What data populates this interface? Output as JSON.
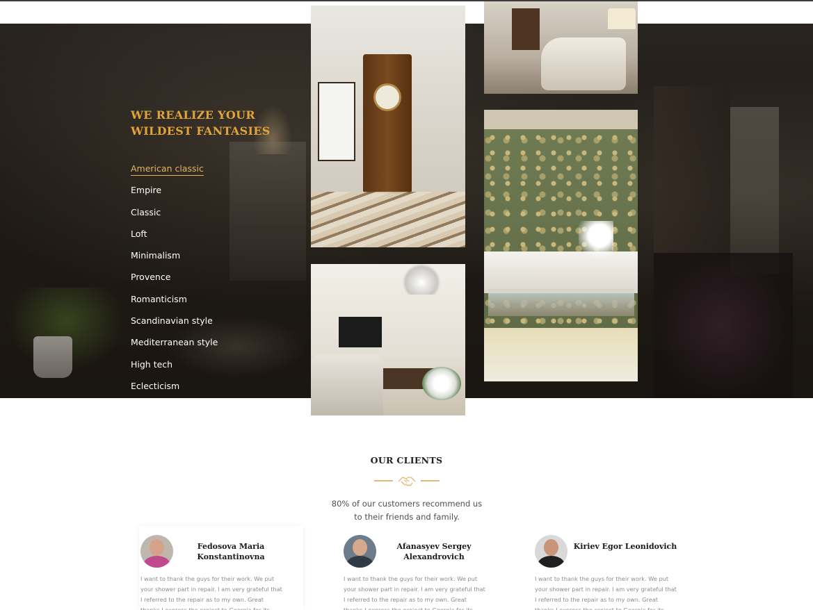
{
  "hero": {
    "title": "WE REALIZE YOUR WILDEST FANTASIES",
    "styles": [
      "American classic",
      "Empire",
      "Classic",
      "Loft",
      "Minimalism",
      "Provence",
      "Romanticism",
      "Scandinavian style",
      "Mediterranean style",
      "High tech",
      "Eclecticism"
    ],
    "active_style": "American classic",
    "accent_color": "#e0a43b"
  },
  "gallery": {
    "photos": [
      {
        "name": "interior-photo-clock-cabinet"
      },
      {
        "name": "interior-photo-tv-room"
      },
      {
        "name": "interior-photo-sofa-lamp"
      },
      {
        "name": "interior-photo-wallpaper-orchid"
      }
    ]
  },
  "clients": {
    "title": "OUR CLIENTS",
    "divider_icon": "handshake-icon",
    "description": "80% of our customers recommend us to their friends and family.",
    "items": [
      {
        "name": "Fedosova Maria Konstantinovna",
        "text": "I want to thank the guys for their work. We put your shower part in repair. I am very grateful that I referred to the repair as to my own. Great thanks I express the project to Georgia for its professionalism and"
      },
      {
        "name": "Afanasyev Sergey Alexandrovich",
        "text": "I want to thank the guys for their work. We put your shower part in repair. I am very grateful that I referred to the repair as to my own. Great thanks I express the project to Georgia for its professionalism and"
      },
      {
        "name": "Kiriev Egor Leonidovich",
        "text": "I want to thank the guys for their work. We put your shower part in repair. I am very grateful that I referred to the repair as to my own. Great thanks I express the project to Georgia for its professionalism and"
      }
    ]
  }
}
